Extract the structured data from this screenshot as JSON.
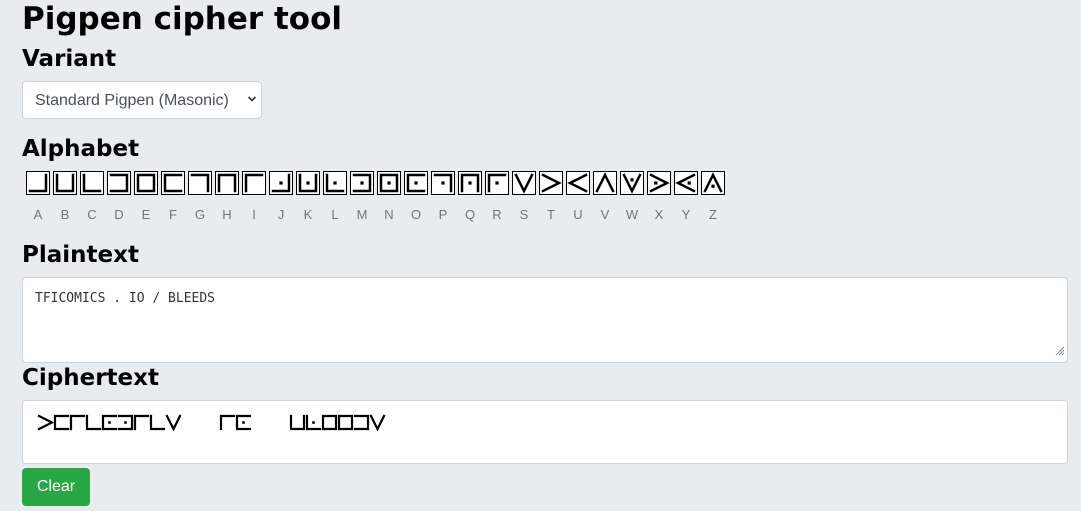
{
  "page": {
    "title": "Pigpen cipher tool"
  },
  "variant": {
    "heading": "Variant",
    "selected": "Standard Pigpen (Masonic)"
  },
  "alphabet": {
    "heading": "Alphabet",
    "letters": [
      "A",
      "B",
      "C",
      "D",
      "E",
      "F",
      "G",
      "H",
      "I",
      "J",
      "K",
      "L",
      "M",
      "N",
      "O",
      "P",
      "Q",
      "R",
      "S",
      "T",
      "U",
      "V",
      "W",
      "X",
      "Y",
      "Z"
    ]
  },
  "plaintext": {
    "heading": "Plaintext",
    "value": "TFICOMICS . IO / BLEEDS"
  },
  "ciphertext": {
    "heading": "Ciphertext",
    "words": [
      "TFICOMICS",
      "IO",
      "BLEEDS"
    ]
  },
  "actions": {
    "clear_label": "Clear"
  },
  "colors": {
    "background": "#e9ecef",
    "clear_button": "#28a745",
    "border": "#ced4da",
    "muted_text": "#6c757d"
  },
  "icons": {
    "select_arrow": "chevron-down-icon",
    "resize": "resize-grip-icon"
  }
}
